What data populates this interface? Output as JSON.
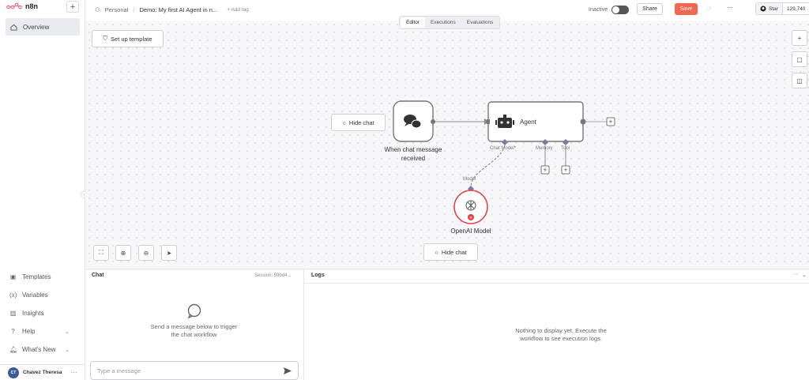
{
  "app": {
    "name": "n8n",
    "new_button": "+"
  },
  "sidebar": {
    "overview": "Overview",
    "bottom_items": [
      {
        "label": "Templates",
        "icon": "box-icon"
      },
      {
        "label": "Variables",
        "icon": "variables-icon"
      },
      {
        "label": "Insights",
        "icon": "chart-icon"
      },
      {
        "label": "Help",
        "icon": "help-icon"
      },
      {
        "label": "What's New",
        "icon": "bell-icon"
      }
    ],
    "user": {
      "initials": "CT",
      "name": "Chavez Theresa"
    }
  },
  "header": {
    "project": "Personal",
    "workflow_name": "Demo: My first AI Agent in n...",
    "add_tag": "+ Add tag",
    "status": "Inactive",
    "share": "Share",
    "save": "Save",
    "github_star": "Star",
    "github_count": "129,740"
  },
  "tabs": [
    "Editor",
    "Executions",
    "Evaluations"
  ],
  "canvas": {
    "setup_template": "Set up template",
    "hide_chat_left": "Hide chat",
    "hide_chat_bottom": "Hide chat",
    "trigger_label_line1": "When chat message",
    "trigger_label_line2": "received",
    "agent_label": "Agent",
    "chat_model_port": "Chat Model*",
    "memory_port": "Memory",
    "tool_port": "Tool",
    "model_port": "Model",
    "openai_label": "OpenAI Model"
  },
  "chat": {
    "title": "Chat",
    "session": "Session: 59bd4...",
    "empty_line1": "Send a message below to trigger",
    "empty_line2": "the chat workflow",
    "placeholder": "Type a message"
  },
  "logs": {
    "title": "Logs",
    "empty_line1": "Nothing to display yet. Execute the",
    "empty_line2": "workflow to see execution logs."
  },
  "colors": {
    "save": "#f2674e",
    "openai_border": "#e0454a",
    "port": "#7b7b9d"
  }
}
